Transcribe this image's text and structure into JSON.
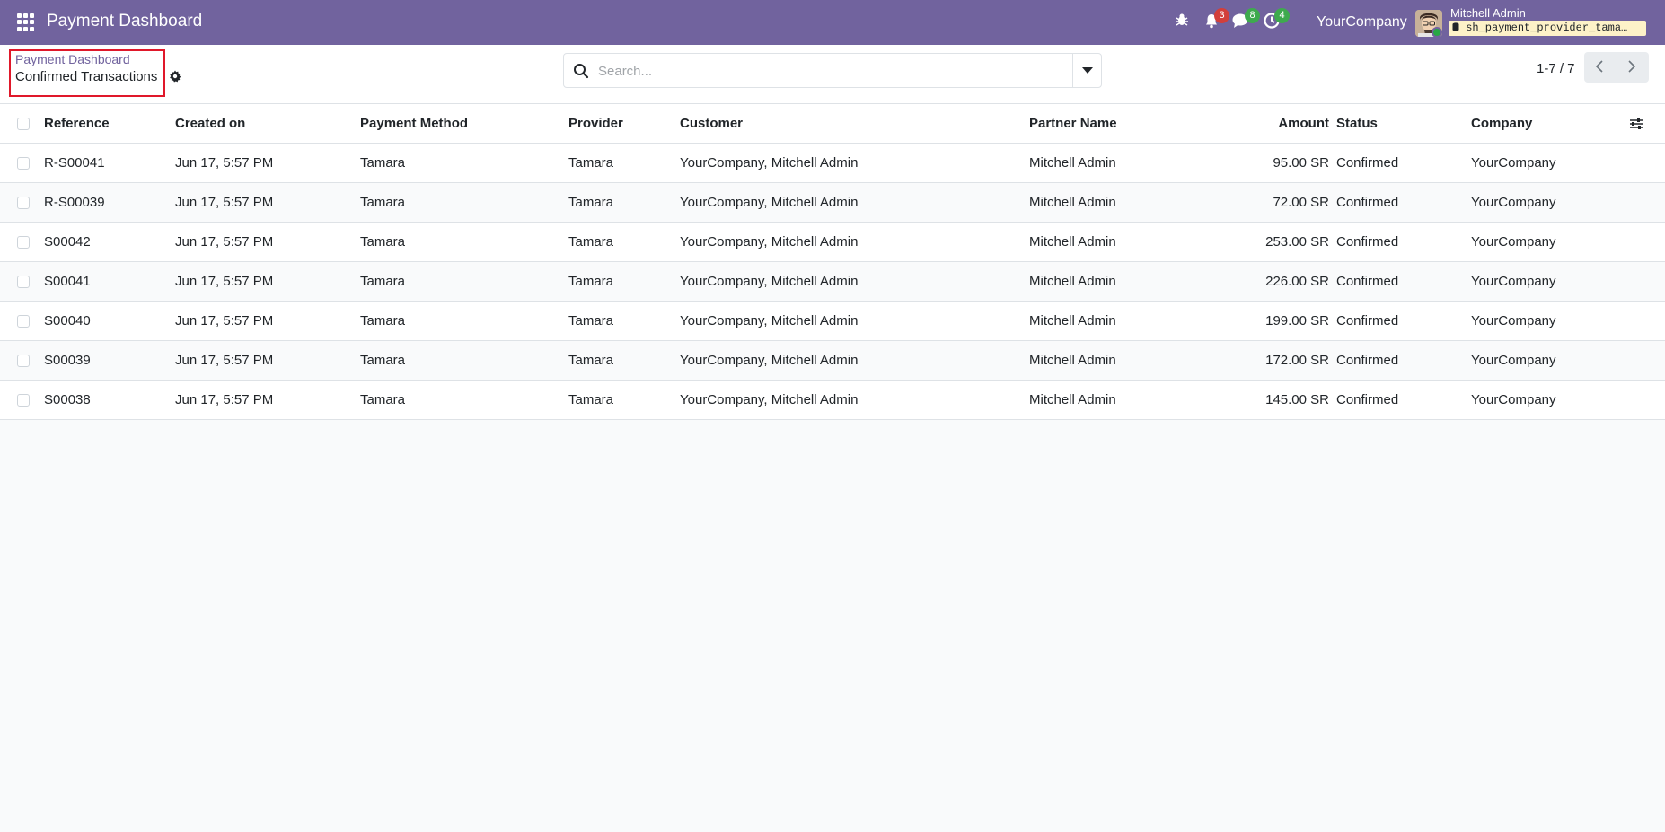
{
  "navbar": {
    "app_title": "Payment Dashboard",
    "notifications_count": "3",
    "messages_count": "8",
    "activities_count": "4",
    "company": "YourCompany",
    "user_name": "Mitchell Admin",
    "database": "sh_payment_provider_tama…",
    "colors": {
      "bar": "#71639e",
      "badge_red": "#d23f3a",
      "badge_green": "#3eaa4e"
    }
  },
  "breadcrumb": {
    "parent": "Payment Dashboard",
    "current": "Confirmed Transactions"
  },
  "search": {
    "placeholder": "Search..."
  },
  "pager": {
    "value": "1-7 / 7"
  },
  "table": {
    "columns": {
      "reference": "Reference",
      "created_on": "Created on",
      "payment_method": "Payment Method",
      "provider": "Provider",
      "customer": "Customer",
      "partner_name": "Partner Name",
      "amount": "Amount",
      "status": "Status",
      "company": "Company"
    },
    "rows": [
      {
        "reference": "R-S00041",
        "created_on": "Jun 17, 5:57 PM",
        "payment_method": "Tamara",
        "provider": "Tamara",
        "customer": "YourCompany, Mitchell Admin",
        "partner_name": "Mitchell Admin",
        "amount": "95.00 SR",
        "status": "Confirmed",
        "company": "YourCompany"
      },
      {
        "reference": "R-S00039",
        "created_on": "Jun 17, 5:57 PM",
        "payment_method": "Tamara",
        "provider": "Tamara",
        "customer": "YourCompany, Mitchell Admin",
        "partner_name": "Mitchell Admin",
        "amount": "72.00 SR",
        "status": "Confirmed",
        "company": "YourCompany"
      },
      {
        "reference": "S00042",
        "created_on": "Jun 17, 5:57 PM",
        "payment_method": "Tamara",
        "provider": "Tamara",
        "customer": "YourCompany, Mitchell Admin",
        "partner_name": "Mitchell Admin",
        "amount": "253.00 SR",
        "status": "Confirmed",
        "company": "YourCompany"
      },
      {
        "reference": "S00041",
        "created_on": "Jun 17, 5:57 PM",
        "payment_method": "Tamara",
        "provider": "Tamara",
        "customer": "YourCompany, Mitchell Admin",
        "partner_name": "Mitchell Admin",
        "amount": "226.00 SR",
        "status": "Confirmed",
        "company": "YourCompany"
      },
      {
        "reference": "S00040",
        "created_on": "Jun 17, 5:57 PM",
        "payment_method": "Tamara",
        "provider": "Tamara",
        "customer": "YourCompany, Mitchell Admin",
        "partner_name": "Mitchell Admin",
        "amount": "199.00 SR",
        "status": "Confirmed",
        "company": "YourCompany"
      },
      {
        "reference": "S00039",
        "created_on": "Jun 17, 5:57 PM",
        "payment_method": "Tamara",
        "provider": "Tamara",
        "customer": "YourCompany, Mitchell Admin",
        "partner_name": "Mitchell Admin",
        "amount": "172.00 SR",
        "status": "Confirmed",
        "company": "YourCompany"
      },
      {
        "reference": "S00038",
        "created_on": "Jun 17, 5:57 PM",
        "payment_method": "Tamara",
        "provider": "Tamara",
        "customer": "YourCompany, Mitchell Admin",
        "partner_name": "Mitchell Admin",
        "amount": "145.00 SR",
        "status": "Confirmed",
        "company": "YourCompany"
      }
    ]
  }
}
